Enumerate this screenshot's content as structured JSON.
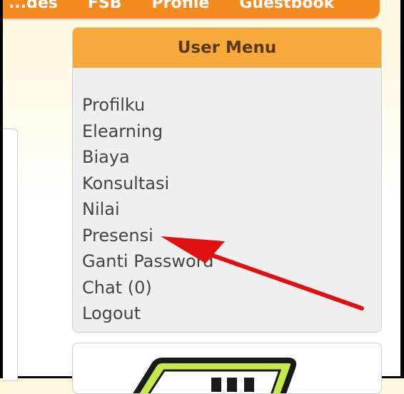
{
  "nav": {
    "items": [
      "...des",
      "FSB",
      "Profile",
      "Guestbook"
    ]
  },
  "user_menu": {
    "title": "User Menu",
    "items": [
      "Profilku",
      "Elearning",
      "Biaya",
      "Konsultasi",
      "Nilai",
      "Presensi",
      "Ganti Password",
      "Chat (0)",
      "Logout"
    ]
  },
  "colors": {
    "nav_orange": "#f58a1f",
    "header_orange": "#f8a93b",
    "annotation_arrow": "#e01010",
    "banner_green": "#c5e84a"
  },
  "annotation": {
    "icon": "red-arrow-icon",
    "points_to": "Presensi"
  }
}
